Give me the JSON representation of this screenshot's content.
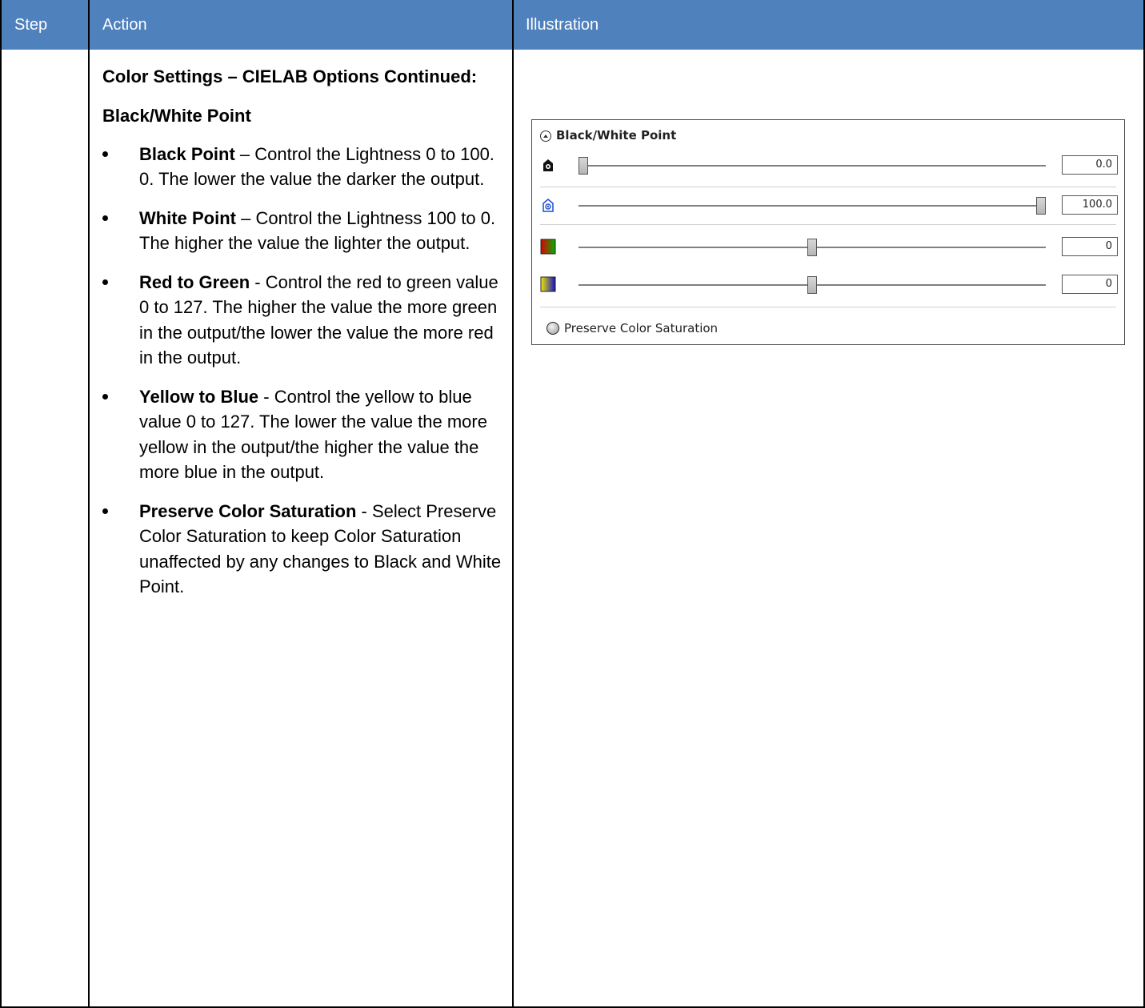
{
  "table": {
    "headers": {
      "step": "Step",
      "action": "Action",
      "illustration": "Illustration"
    }
  },
  "action": {
    "title": "Color Settings – CIELAB Options Continued:",
    "subheading": "Black/White Point",
    "bullets": [
      {
        "term": "Black Point",
        "text": " – Control the Lightness 0 to 100. 0. The lower the value the darker the output."
      },
      {
        "term": "White Point",
        "text": " – Control the Lightness 100 to 0. The higher the value the lighter the output."
      },
      {
        "term": "Red to Green",
        "text": " - Control the red to green value 0 to 127. The higher the value the more green in the output/the lower the value the more red in the output."
      },
      {
        "term": "Yellow to Blue",
        "text": " - Control the yellow to blue value 0 to 127. The lower the value the more yellow in the output/the higher the value the more blue in the output."
      },
      {
        "term": "Preserve Color Saturation",
        "text": " - Select Preserve Color Saturation to keep Color Saturation unaffected by any changes to Black and White Point."
      }
    ]
  },
  "panel": {
    "title": "Black/White Point",
    "sliders": [
      {
        "name": "black-point",
        "icon": "black-point-icon",
        "value": "0.0",
        "level": 0.0
      },
      {
        "name": "white-point",
        "icon": "white-point-icon",
        "value": "100.0",
        "level": 1.0
      },
      {
        "name": "red-green",
        "icon": "red-green-swatch-icon",
        "value": "0",
        "level": 0.5
      },
      {
        "name": "yellow-blue",
        "icon": "yellow-blue-swatch-icon",
        "value": "0",
        "level": 0.5
      }
    ],
    "preserve_label": "Preserve Color Saturation"
  },
  "colors": {
    "header_bg": "#4f81bd",
    "header_text": "#ffffff"
  }
}
